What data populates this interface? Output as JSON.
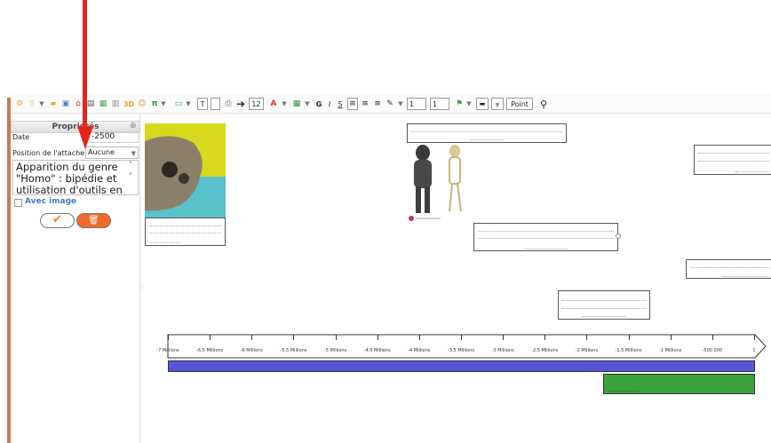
{
  "toolbar": {
    "font_size": "12",
    "bold": "G",
    "italic": "I",
    "underline": "S",
    "line_width_1": "1",
    "line_width_2": "1",
    "unit": "Point",
    "three_d": "3D"
  },
  "panel": {
    "title": "Propriétés",
    "date_label": "Date",
    "date_value": "-2500",
    "attach_label": "Position de l'attache",
    "attach_value": "Aucune",
    "description": "Apparition du genre \"Homo\" : bipédie et utilisation d'outils en pierre",
    "image_checkbox_label": "Avec image"
  },
  "timeline": {
    "ticks": [
      "-7 Millions",
      "-6.5 Millions",
      "-6 Millions",
      "-5.5 Millions",
      "-5 Millions",
      "-4.5 Millions",
      "-4 Millions",
      "-3.5 Millions",
      "-3 Millions",
      "-2.5 Millions",
      "-2 Millions",
      "-1.5 Millions",
      "-1 Millions",
      "-500 000",
      "1"
    ]
  },
  "colors": {
    "arrow": "#e32619",
    "panel_border": "#c87a55",
    "blue_bar": "#5556d6",
    "green_bar": "#3aa23a",
    "delete_button": "#f06a2a"
  }
}
